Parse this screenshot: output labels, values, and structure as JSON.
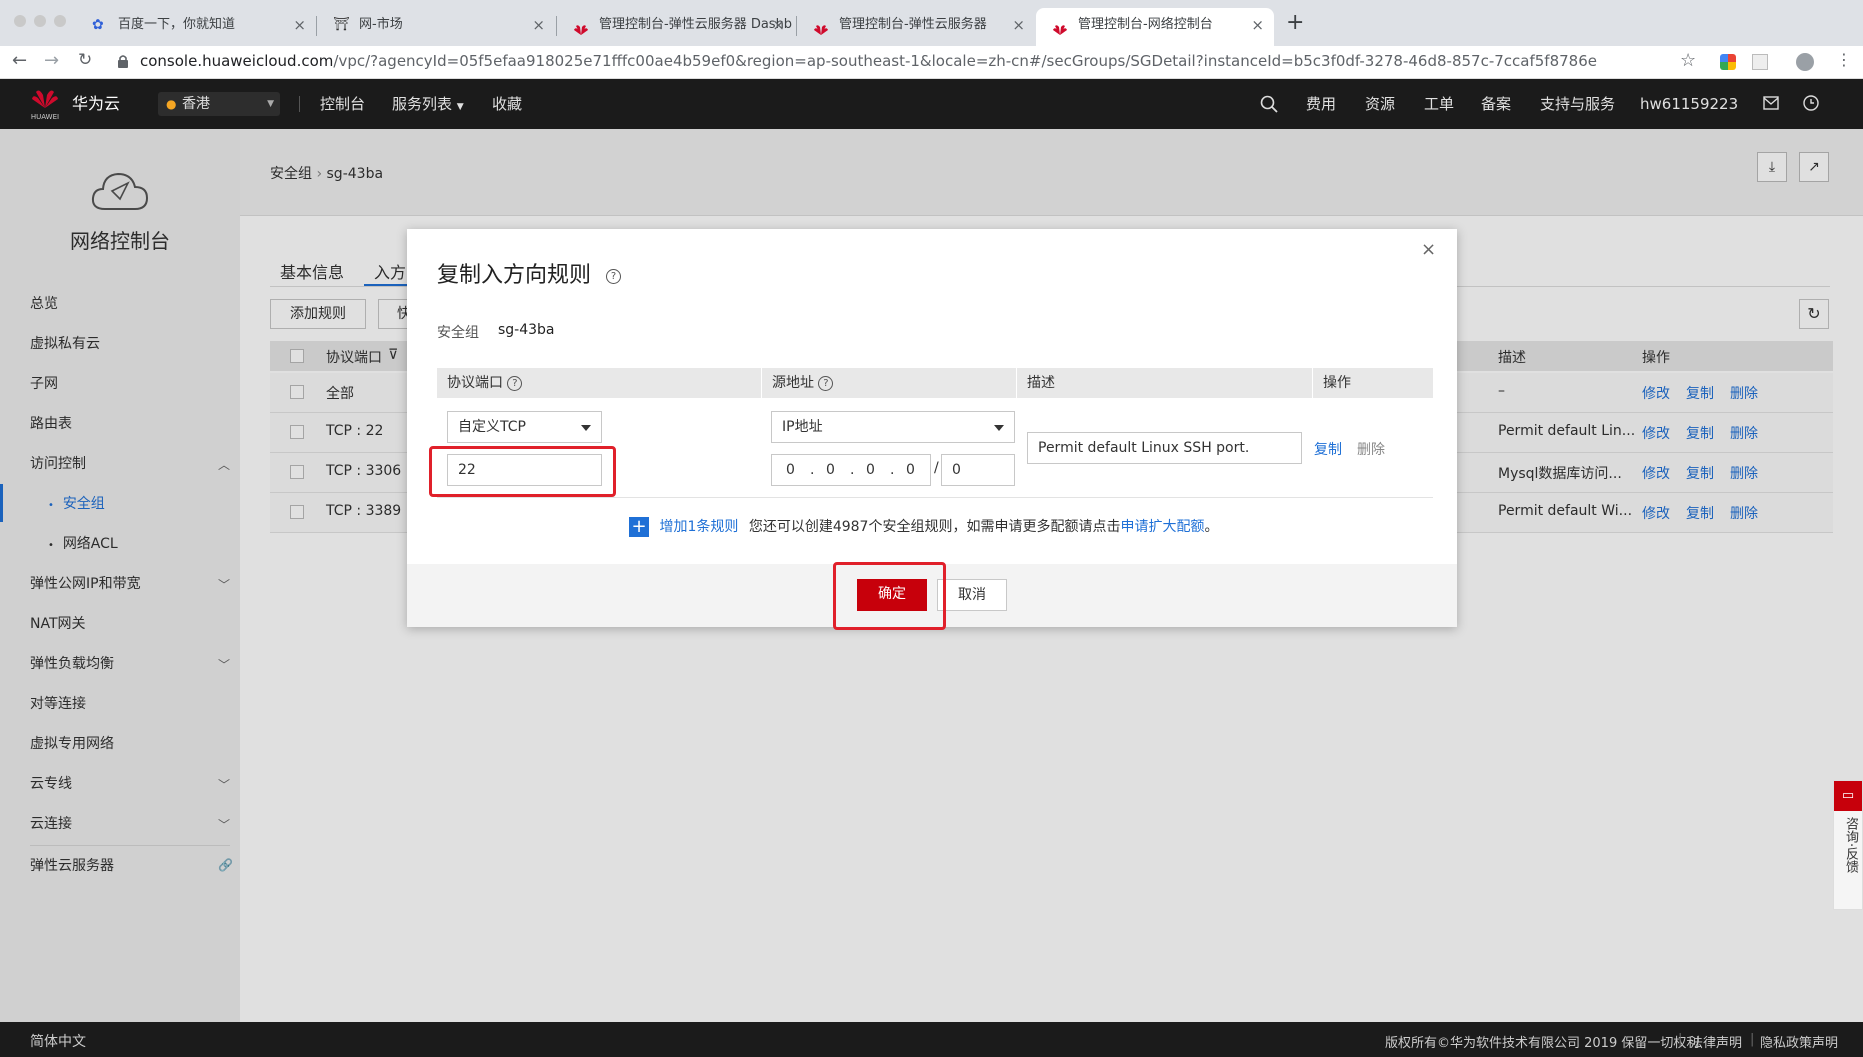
{
  "browser": {
    "tabs": [
      {
        "title": "百度一下，你就知道",
        "close": "×"
      },
      {
        "title": "网-市场",
        "close": "×"
      },
      {
        "title": "管理控制台-弹性云服务器 Dashb",
        "close": "×"
      },
      {
        "title": "管理控制台-弹性云服务器",
        "close": "×"
      },
      {
        "title": "管理控制台-网络控制台",
        "close": "×"
      }
    ],
    "new_tab": "+",
    "url_host": "console.huaweicloud.com",
    "url_path": "/vpc/?agencyId=05f5efaa918025e71fffc00ae4b59ef0&region=ap-southeast-1&locale=zh-cn#/secGroups/SGDetail?instanceId=b5c3f0df-3278-46d8-857c-7ccaf5f8786e"
  },
  "topnav": {
    "logo_text": "HUAWEI",
    "brand": "华为云",
    "region": "香港",
    "console": "控制台",
    "services": "服务列表",
    "favorites": "收藏",
    "fees": "费用",
    "resources": "资源",
    "tickets": "工单",
    "icp": "备案",
    "support": "支持与服务",
    "user": "hw61159223"
  },
  "sidebar": {
    "title": "网络控制台",
    "items": [
      {
        "label": "总览"
      },
      {
        "label": "虚拟私有云"
      },
      {
        "label": "子网"
      },
      {
        "label": "路由表"
      },
      {
        "label": "访问控制"
      },
      {
        "label": "安全组"
      },
      {
        "label": "网络ACL"
      },
      {
        "label": "弹性公网IP和带宽"
      },
      {
        "label": "NAT网关"
      },
      {
        "label": "弹性负载均衡"
      },
      {
        "label": "对等连接"
      },
      {
        "label": "虚拟专用网络"
      },
      {
        "label": "云专线"
      },
      {
        "label": "云连接"
      },
      {
        "label": "弹性云服务器"
      }
    ]
  },
  "main": {
    "breadcrumb_root": "安全组",
    "breadcrumb_current": "sg-43ba",
    "tabs": [
      "基本信息",
      "入方"
    ],
    "add_rule": "添加规则",
    "quick_partial": "快",
    "col_protocol": "协议端口",
    "col_desc": "描述",
    "col_action": "操作",
    "rows": [
      {
        "proto": "全部",
        "desc": "–"
      },
      {
        "proto": "TCP : 22",
        "desc": "Permit default Lin..."
      },
      {
        "proto": "TCP : 3306",
        "desc": "Mysql数据库访问..."
      },
      {
        "proto": "TCP : 3389",
        "desc": "Permit default Wi..."
      }
    ],
    "act_modify": "修改",
    "act_copy": "复制",
    "act_delete": "删除"
  },
  "dialog": {
    "title": "复制入方向规则",
    "sg_label": "安全组",
    "sg_value": "sg-43ba",
    "col_protocol": "协议端口",
    "col_source": "源地址",
    "col_desc": "描述",
    "col_action": "操作",
    "protocol_select": "自定义TCP",
    "port_value": "22",
    "source_select": "IP地址",
    "ip_octets": [
      "0",
      "0",
      "0",
      "0"
    ],
    "mask": "0",
    "description_value": "Permit default Linux SSH port.",
    "row_copy": "复制",
    "row_delete": "删除",
    "add_one": "增加1条规则",
    "quota_text": "您还可以创建4987个安全组规则，如需申请更多配额请点击",
    "quota_link": "申请扩大配额",
    "quota_end": "。",
    "ok": "确定",
    "cancel": "取消"
  },
  "feedback": "咨询·反馈",
  "footer": {
    "lang": "简体中文",
    "copyright": "版权所有©华为软件技术有限公司 2019 保留一切权利",
    "legal": "法律声明",
    "privacy": "隐私政策声明"
  }
}
